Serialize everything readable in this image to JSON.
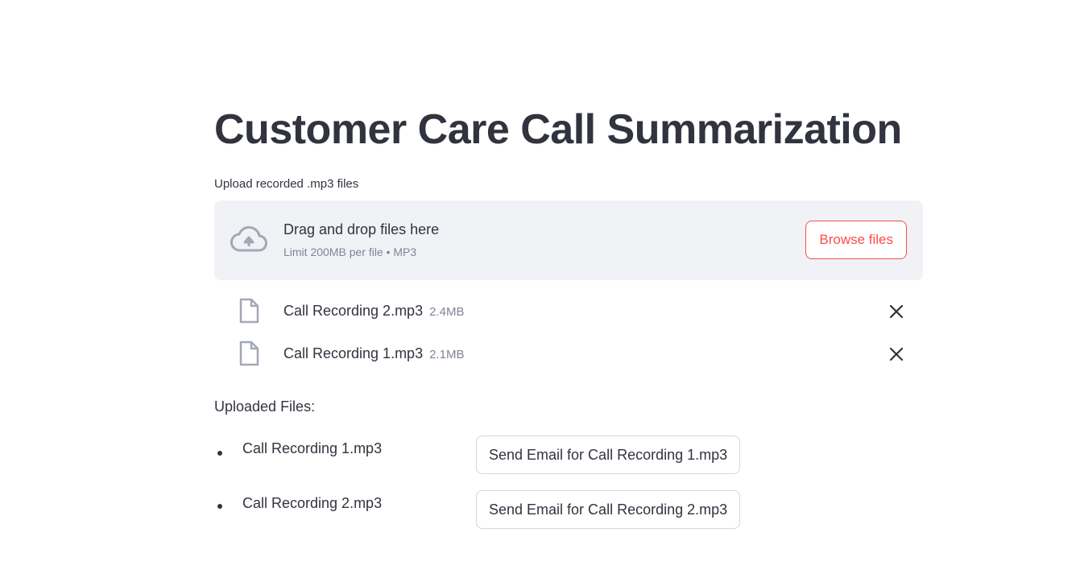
{
  "page": {
    "title": "Customer Care Call Summarization"
  },
  "uploader": {
    "label": "Upload recorded .mp3 files",
    "drop_title": "Drag and drop files here",
    "drop_subtitle": "Limit 200MB per file • MP3",
    "browse_label": "Browse files",
    "icon": "cloud-upload-icon",
    "files": [
      {
        "name": "Call Recording 2.mp3",
        "size": "2.4MB",
        "icon": "file-icon",
        "remove_icon": "close-icon"
      },
      {
        "name": "Call Recording 1.mp3",
        "size": "2.1MB",
        "icon": "file-icon",
        "remove_icon": "close-icon"
      }
    ]
  },
  "uploaded": {
    "heading": "Uploaded Files:",
    "items": [
      {
        "name": "Call Recording 1.mp3",
        "button_label": "Send Email for Call Recording 1.mp3"
      },
      {
        "name": "Call Recording 2.mp3",
        "button_label": "Send Email for Call Recording 2.mp3"
      }
    ]
  },
  "colors": {
    "accent": "#ff4b4b",
    "text": "#31333f",
    "muted": "#808495",
    "dropzone_bg": "#f0f2f6",
    "icon": "#a3a8b8"
  }
}
